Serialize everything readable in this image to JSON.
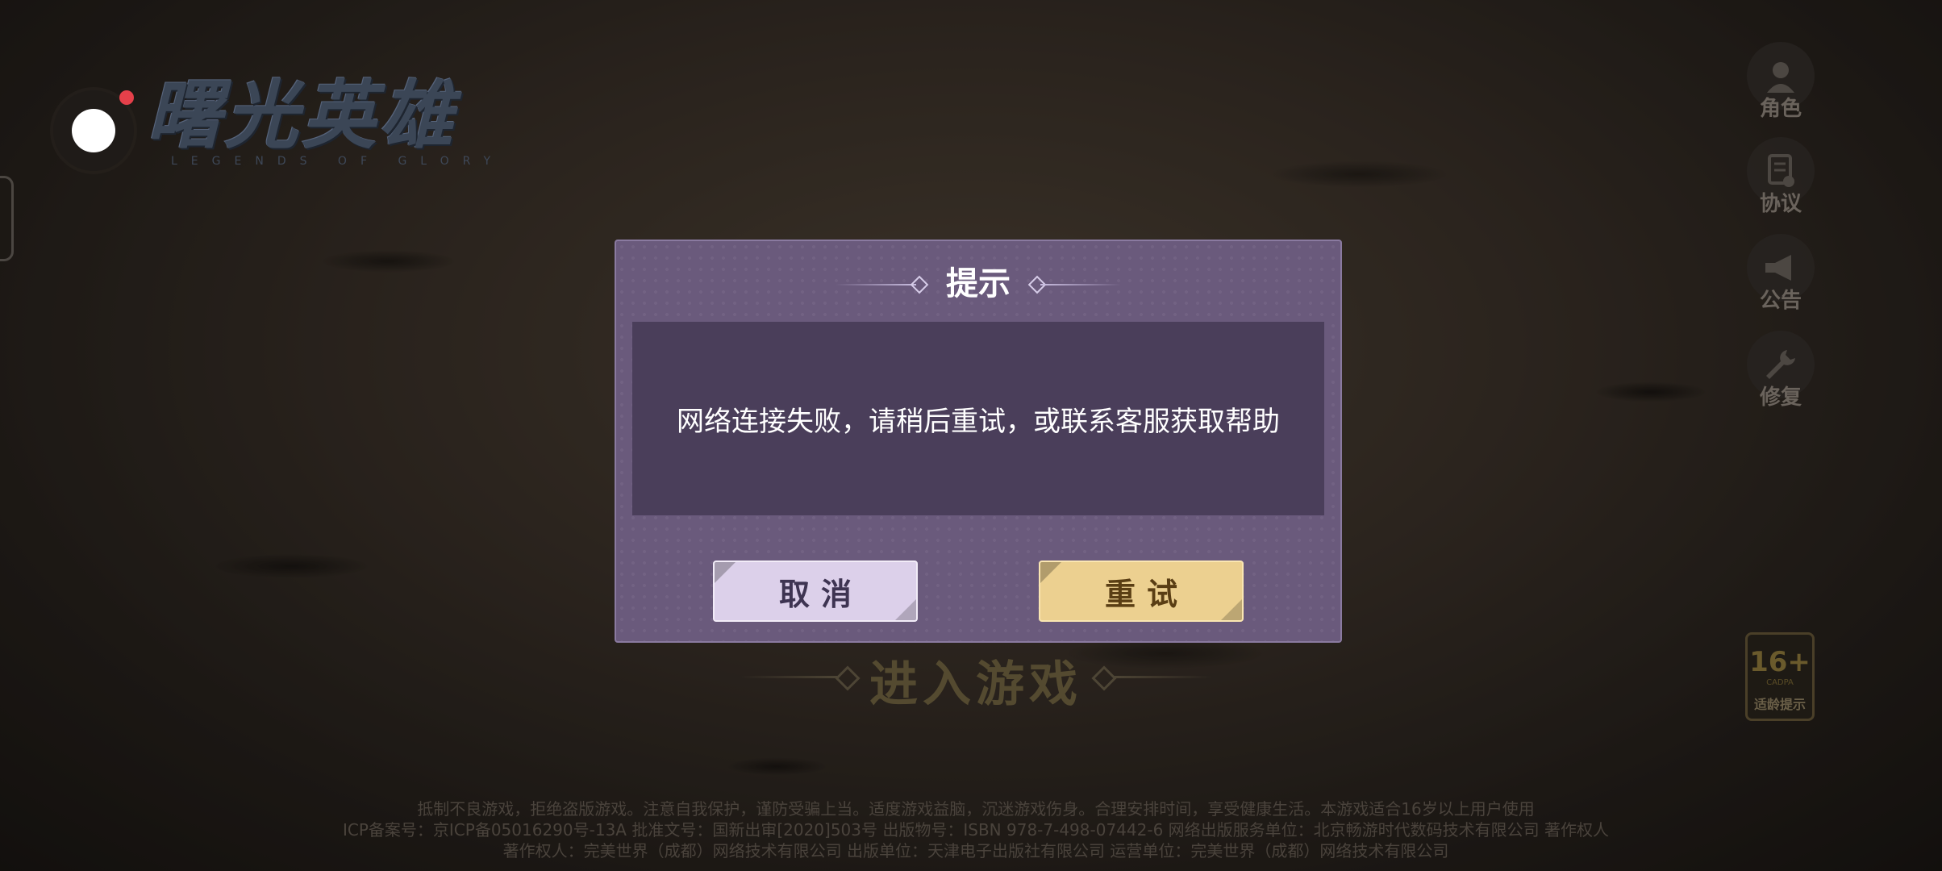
{
  "app": {
    "logo_cn": "曙光英雄",
    "logo_en": "LEGENDS OF GLORY"
  },
  "side_menu": [
    {
      "icon": "character-icon",
      "label": "角色"
    },
    {
      "icon": "agreement-icon",
      "label": "协议"
    },
    {
      "icon": "megaphone-icon",
      "label": "公告"
    },
    {
      "icon": "wrench-icon",
      "label": "修复"
    }
  ],
  "age_badge": {
    "rating": "16+",
    "org": "CADPA",
    "label": "适龄提示"
  },
  "enter_game_label": "进入游戏",
  "dialog": {
    "title": "提示",
    "message": "网络连接失败，请稍后重试，或联系客服获取帮助",
    "cancel_label": "取消",
    "retry_label": "重试"
  },
  "footer": {
    "line1": "抵制不良游戏，拒绝盗版游戏。注意自我保护，谨防受骗上当。适度游戏益脑，沉迷游戏伤身。合理安排时间，享受健康生活。本游戏适合16岁以上用户使用",
    "line2": "ICP备案号：京ICP备05016290号-13A 批准文号：国新出审[2020]503号 出版物号：ISBN 978-7-498-07442-6 网络出版服务单位：北京畅游时代数码技术有限公司 著作权人",
    "line3": "著作权人：完美世界（成都）网络技术有限公司 出版单位：天津电子出版社有限公司 运营单位：完美世界（成都）网络技术有限公司"
  },
  "colors": {
    "dialog_bg": "#6a5a7c",
    "dialog_body_bg": "#4a3e5a",
    "cancel_bg": "#dcd0ea",
    "retry_bg": "#ecd090"
  }
}
